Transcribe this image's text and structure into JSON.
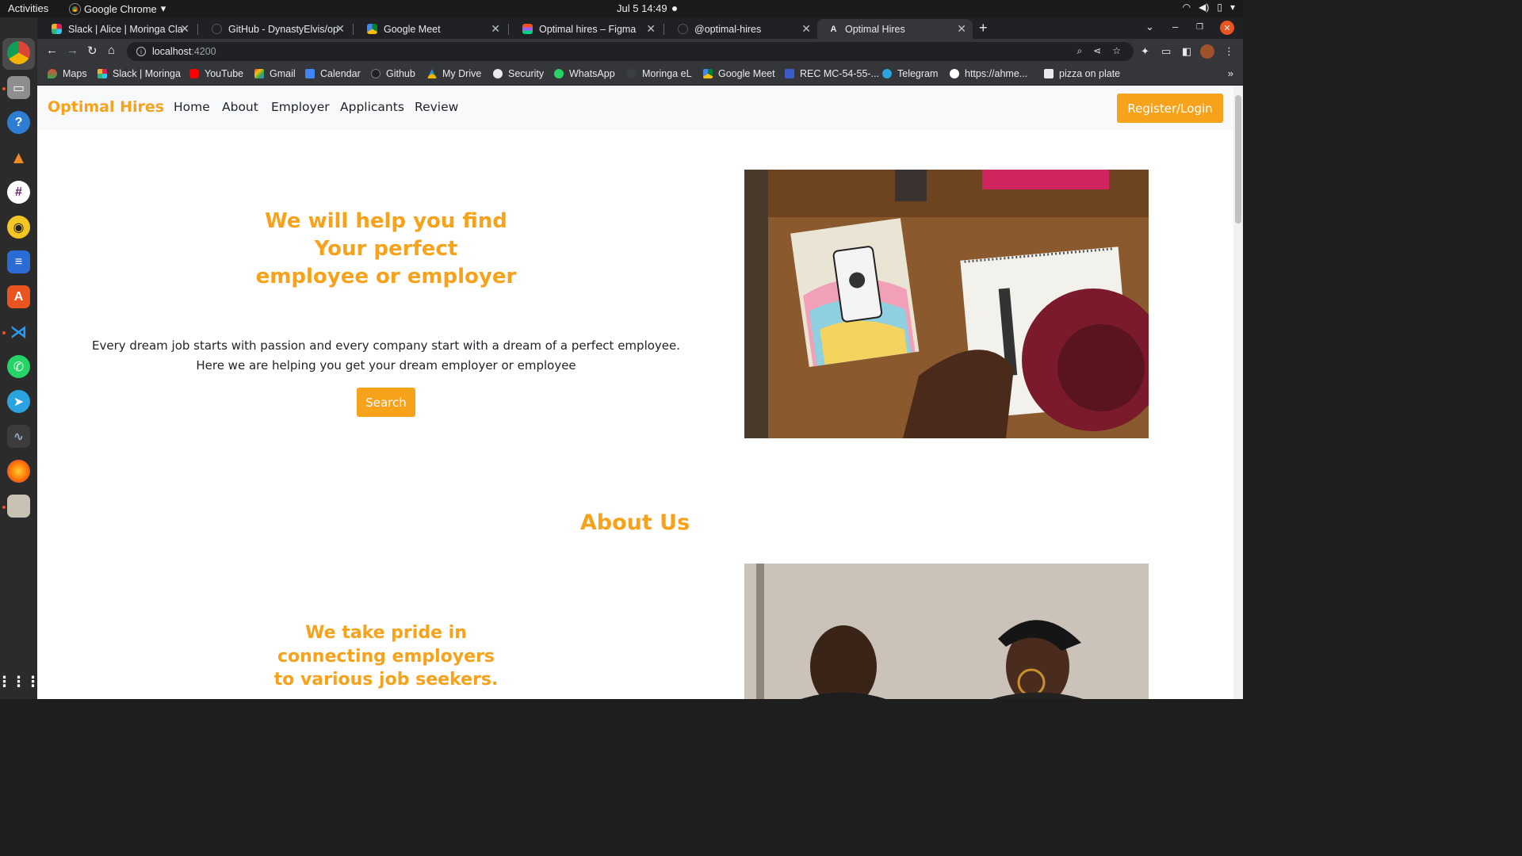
{
  "system": {
    "activities": "Activities",
    "app_name": "Google Chrome",
    "clock": "Jul 5  14:49"
  },
  "browser": {
    "tabs": [
      {
        "title": "Slack | Alice | Moringa Cla",
        "favicon": "slack-icon",
        "active": false
      },
      {
        "title": "GitHub - DynastyElvis/op",
        "favicon": "github-icon",
        "active": false
      },
      {
        "title": "Google Meet",
        "favicon": "google-meet-icon",
        "active": false
      },
      {
        "title": "Optimal hires – Figma",
        "favicon": "figma-icon",
        "active": false
      },
      {
        "title": "@optimal-hires",
        "favicon": "github-icon",
        "active": false
      },
      {
        "title": "Optimal Hires",
        "favicon": "angular-icon",
        "active": true
      }
    ],
    "url_host": "localhost",
    "url_port": ":4200",
    "bookmarks": [
      {
        "label": "Maps",
        "icon": "maps-icon"
      },
      {
        "label": "Slack | Moringa",
        "icon": "slack-icon"
      },
      {
        "label": "YouTube",
        "icon": "youtube-icon"
      },
      {
        "label": "Gmail",
        "icon": "gmail-icon"
      },
      {
        "label": "Calendar",
        "icon": "calendar-icon"
      },
      {
        "label": "Github",
        "icon": "github-icon"
      },
      {
        "label": "My Drive",
        "icon": "drive-icon"
      },
      {
        "label": "Security",
        "icon": "security-icon"
      },
      {
        "label": "WhatsApp",
        "icon": "whatsapp-icon"
      },
      {
        "label": "Moringa eL",
        "icon": "moringa-icon"
      },
      {
        "label": "Google Meet",
        "icon": "google-meet-icon"
      },
      {
        "label": "REC MC-54-55-...",
        "icon": "rec-icon"
      },
      {
        "label": "Telegram",
        "icon": "telegram-icon"
      },
      {
        "label": "https://ahme...",
        "icon": "medium-icon"
      },
      {
        "label": "pizza on plate",
        "icon": "pizza-icon"
      }
    ]
  },
  "site": {
    "brand": "Optimal Hires",
    "nav": [
      "Home",
      "About",
      "Employer",
      "Applicants",
      "Review"
    ],
    "register_label": "Register/Login",
    "hero": {
      "title_lines": [
        "We will help you find",
        "Your perfect",
        "employee or employer"
      ],
      "text_lines": [
        "Every dream job starts with passion and every company start with a dream of a perfect employee.",
        "Here we are helping you get your dream employer or employee"
      ],
      "search_label": "Search"
    },
    "about": {
      "heading": "About Us",
      "title_lines": [
        "We take pride in",
        "connecting employers",
        "to various job seekers."
      ]
    },
    "accent_color": "#f7a21b"
  }
}
